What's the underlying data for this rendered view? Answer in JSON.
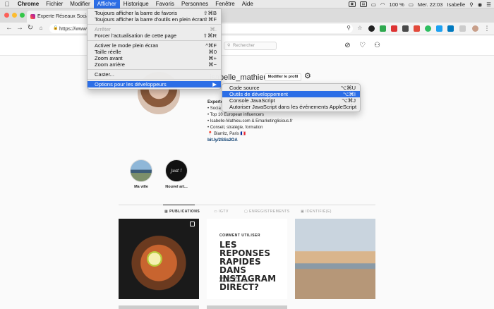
{
  "menubar": {
    "app": "Chrome",
    "items": [
      "Fichier",
      "Modifier",
      "Afficher",
      "Historique",
      "Favoris",
      "Personnes",
      "Fenêtre",
      "Aide"
    ],
    "battery": "100 %",
    "clock": "Mer. 22:03",
    "user": "Isabelle"
  },
  "browser": {
    "tab_title": "Experte Réseaux Sociaux",
    "address": "https://www"
  },
  "instagram": {
    "search_placeholder": "Rechercher",
    "username": "isabelle_mathieu",
    "edit_profile": "Modifier le profil",
    "bio": {
      "title": "Experte",
      "line1": "• Socia",
      "line2": "• Top 10 European influencers",
      "line3": "• Isabelle-Mathieu.com & Emarketinglicious.fr",
      "line4": "• Conseil, stratégie, formation",
      "line5": "📍 Biarritz, Paris 🇫🇷",
      "link": "bit.ly/2SSs2OA"
    },
    "highlights": [
      {
        "label": "Ma ville"
      },
      {
        "label": "Nouvel art...",
        "cover_text": "just !"
      }
    ],
    "tabs": [
      "PUBLICATIONS",
      "IGTV",
      "ENREGISTREMENTS",
      "IDENTIFIÉ(E)"
    ],
    "post2": {
      "kicker": "COMMENT UTILISER",
      "headline": "LES REPONSES RAPIDES DANS INSTAGRAM DIRECT?",
      "small1": "(Nouvel article)",
      "small2": "EMARKETINGLICIOUS.FR"
    }
  },
  "view_menu": {
    "items": [
      {
        "label": "Toujours afficher la barre de favoris",
        "shortcut": "⇧⌘B",
        "state": "normal"
      },
      {
        "label": "Toujours afficher la barre d'outils en plein écran",
        "shortcut": "⇧⌘F",
        "state": "normal"
      },
      {
        "label": "Arrêter",
        "shortcut": "⌘.",
        "state": "disabled"
      },
      {
        "label": "Forcer l'actualisation de cette page",
        "shortcut": "⇧⌘R",
        "state": "normal"
      },
      {
        "label": "Activer le mode plein écran",
        "shortcut": "^⌘F",
        "state": "normal"
      },
      {
        "label": "Taille réelle",
        "shortcut": "⌘0",
        "state": "normal"
      },
      {
        "label": "Zoom avant",
        "shortcut": "⌘+",
        "state": "normal"
      },
      {
        "label": "Zoom arrière",
        "shortcut": "⌘−",
        "state": "normal"
      },
      {
        "label": "Caster...",
        "shortcut": "",
        "state": "normal"
      },
      {
        "label": "Options pour les développeurs",
        "shortcut": "▶",
        "state": "highlighted"
      }
    ]
  },
  "dev_submenu": {
    "items": [
      {
        "label": "Code source",
        "shortcut": "⌥⌘U",
        "state": "normal"
      },
      {
        "label": "Outils de développement",
        "shortcut": "⌥⌘I",
        "state": "highlighted"
      },
      {
        "label": "Console JavaScript",
        "shortcut": "⌥⌘J",
        "state": "normal"
      },
      {
        "label": "Autoriser JavaScript dans les événements AppleScript",
        "shortcut": "",
        "state": "normal"
      }
    ]
  }
}
